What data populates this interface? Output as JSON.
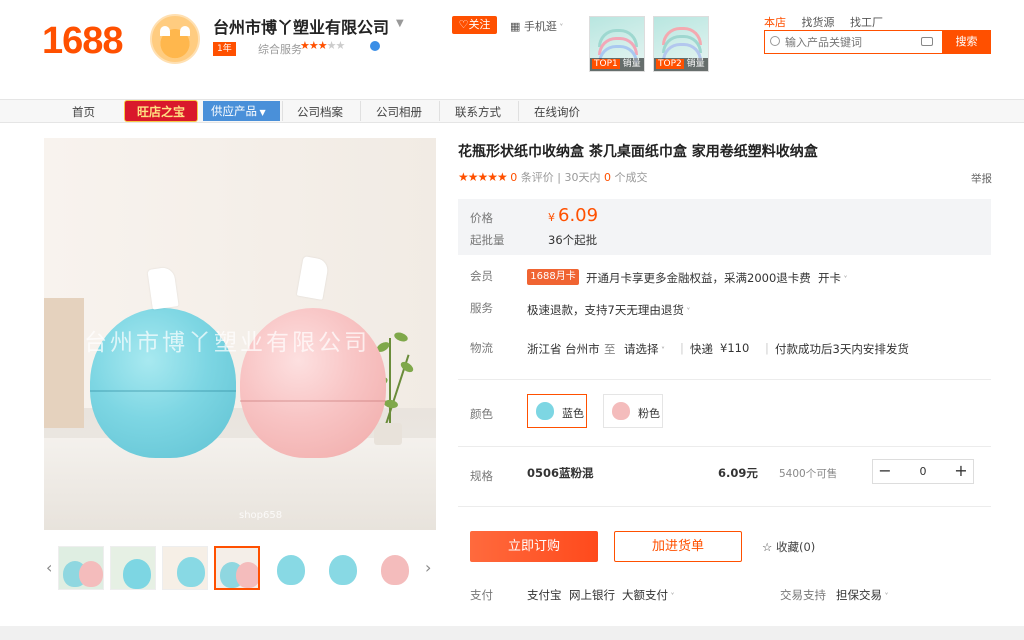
{
  "header": {
    "logo": "1688",
    "company_name": "台州市博丫塑业有限公司",
    "year_badge": "1年",
    "service_label": "综合服务",
    "follow_label": "关注",
    "mobile_label": "手机逛",
    "top_items": [
      {
        "rank": "TOP1",
        "label": "销量"
      },
      {
        "rank": "TOP2",
        "label": "销量"
      }
    ],
    "search_tabs": [
      "本店",
      "找货源",
      "找工厂"
    ],
    "search_placeholder": "输入产品关键词",
    "search_button": "搜索",
    "accent_color": "#ff5000"
  },
  "nav": {
    "items": [
      "首页",
      "旺店之宝",
      "供应产品",
      "公司档案",
      "公司相册",
      "联系方式",
      "在线询价"
    ]
  },
  "gallery": {
    "watermark": "台州市博丫塑业有限公司",
    "watermark_url": "shop658"
  },
  "product": {
    "title": "花瓶形状纸巾收纳盒 茶几桌面纸巾盒 家用卷纸塑料收纳盒",
    "reviews_count": "0",
    "reviews_label": "条评价",
    "deals_prefix": "30天内",
    "deals_count": "0",
    "deals_label": "个成交",
    "report": "举报",
    "price_label": "价格",
    "currency": "¥",
    "price": "6.09",
    "moq_label": "起批量",
    "moq": "36个起批",
    "member_label": "会员",
    "card_badge": "1688月卡",
    "member_text": "开通月卡享更多金融权益，采满2000退卡费",
    "open_card": "开卡",
    "service_label": "服务",
    "service_text": "极速退款，支持7天无理由退货",
    "logistics_label": "物流",
    "from": "浙江省 台州市",
    "to_label": "至",
    "to_select": "请选择",
    "express": "快递",
    "express_fee": "¥110",
    "ship_text": "付款成功后3天内安排发货",
    "color_label": "颜色",
    "colors": [
      {
        "name": "蓝色",
        "swatch": "#7dd6e3"
      },
      {
        "name": "粉色",
        "swatch": "#f4bcbc"
      }
    ],
    "spec_label": "规格",
    "spec_name": "0506蓝粉混",
    "spec_price": "6.09元",
    "spec_stock": "5400个可售",
    "quantity": "0",
    "order_button": "立即订购",
    "cart_button": "加进货单",
    "favorite": "收藏(0)",
    "pay_label": "支付",
    "pay_methods": [
      "支付宝",
      "网上银行",
      "大额支付"
    ],
    "trade_label": "交易支持",
    "trade_value": "担保交易"
  }
}
